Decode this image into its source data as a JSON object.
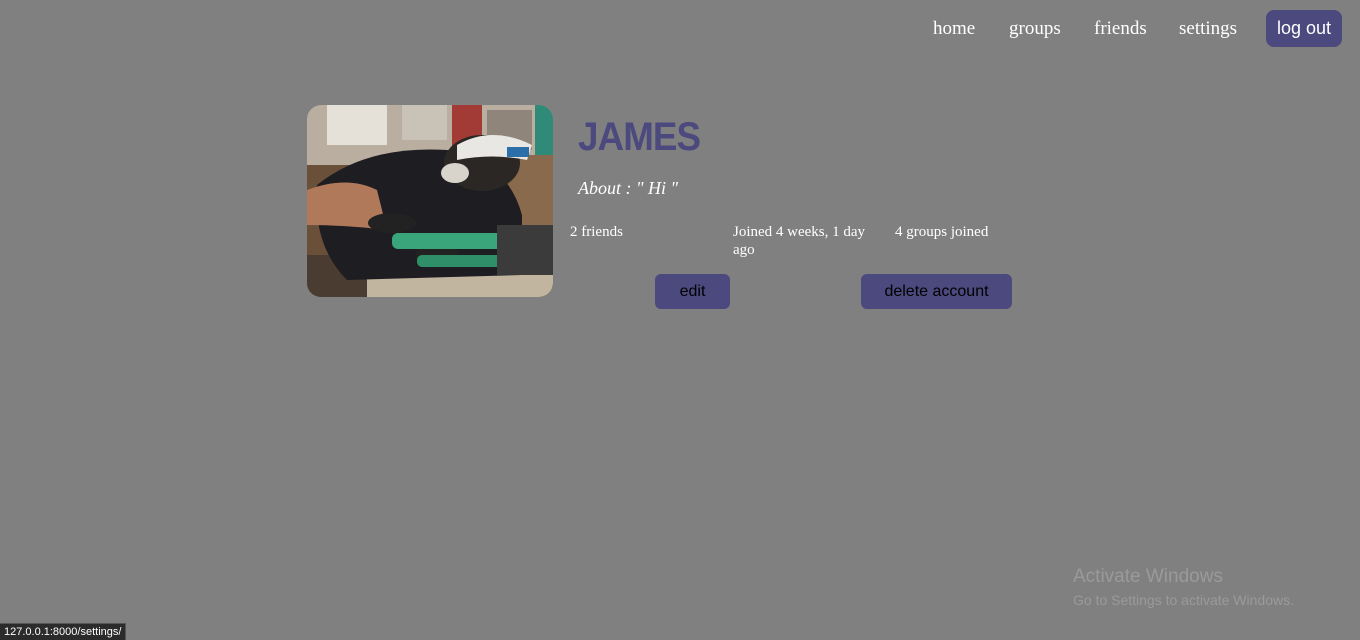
{
  "nav": {
    "home": "home",
    "groups": "groups",
    "friends": "friends",
    "settings": "settings",
    "logout": "log out"
  },
  "profile": {
    "name": "JAMES",
    "about_label": "About :",
    "about_value": "\" Hi \"",
    "friends": "2 friends",
    "joined": "Joined 4 weeks, 1 day ago",
    "groups": "4 groups joined",
    "edit_label": "edit",
    "delete_label": "delete account"
  },
  "watermark": {
    "title": "Activate Windows",
    "subtitle": "Go to Settings to activate Windows."
  },
  "status_bar": {
    "url": "127.0.0.1:8000/settings/"
  },
  "colors": {
    "background": "#808080",
    "accent": "#4b497d"
  }
}
